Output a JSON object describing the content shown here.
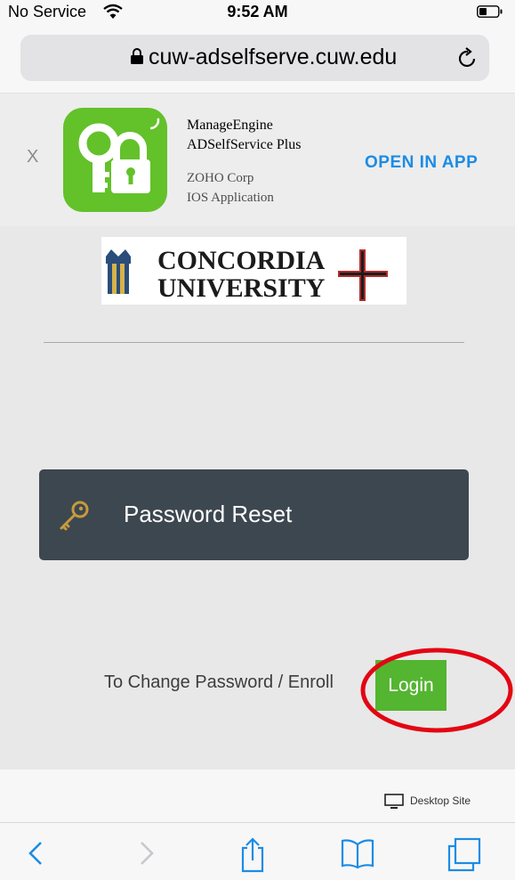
{
  "status_bar": {
    "carrier": "No Service",
    "time": "9:52 AM"
  },
  "browser": {
    "url": "cuw-adselfserve.cuw.edu"
  },
  "app_banner": {
    "close_label": "X",
    "app_name_line1": "ManageEngine",
    "app_name_line2": "ADSelfService Plus",
    "vendor": "ZOHO Corp",
    "app_type": "IOS Application",
    "open_label": "OPEN IN APP"
  },
  "page": {
    "logo_line1": "CONCORDIA",
    "logo_line2": "UNIVERSITY",
    "password_reset_label": "Password Reset",
    "change_password_text": "To Change Password / Enroll",
    "login_label": "Login"
  },
  "footer": {
    "desktop_site_label": "Desktop Site"
  },
  "colors": {
    "accent_blue": "#1c8ce5",
    "login_green": "#54b530",
    "panel_dark": "#3d4750",
    "annotation_red": "#e30613"
  }
}
